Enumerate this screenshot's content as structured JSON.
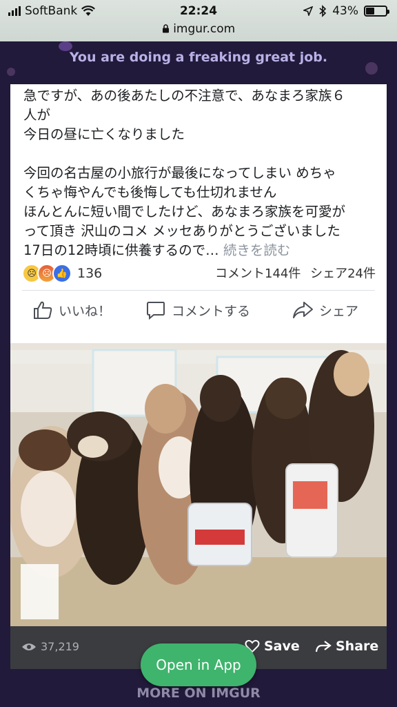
{
  "status": {
    "carrier": "SoftBank",
    "time": "22:24",
    "battery": "43%",
    "battery_level": 0.43,
    "url": "imgur.com"
  },
  "banner": {
    "text": "You are doing a freaking great job."
  },
  "post": {
    "lines": [
      "急ですが、あの後あたしの不注意で、あなまろ家族６",
      "人が",
      "今日の昼に亡くなりました",
      "",
      "今回の名古屋の小旅行が最後になってしまい めちゃ",
      "くちゃ悔やんでも後悔しても仕切れません",
      "ほんとんに短い間でしたけど、あなまろ家族を可愛が",
      "って頂き 沢山のコメ メッセありがとうございました"
    ],
    "last_line": "17日の12時頃に供養するので…",
    "read_more": "続きを読む",
    "reaction_count": "136",
    "comments": "コメント144件",
    "shares": "シェア24件",
    "actions": {
      "like": "いいね！",
      "comment": "コメントする",
      "share": "シェア"
    }
  },
  "bottom": {
    "views": "37,219",
    "save": "Save",
    "share": "Share",
    "open_in_app": "Open in App",
    "more_on": "MORE ON IMGUR"
  }
}
